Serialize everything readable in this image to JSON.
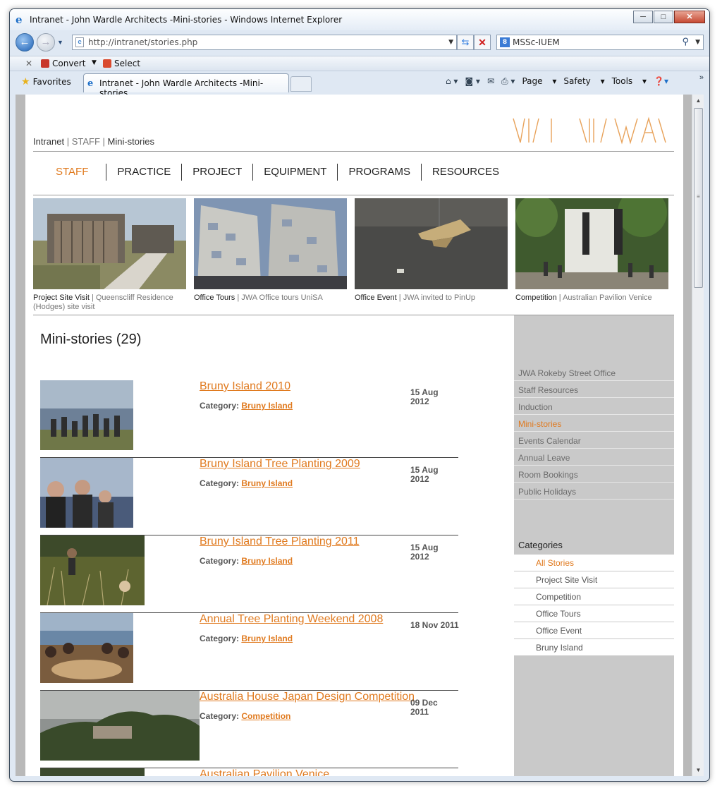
{
  "window": {
    "title": "Intranet - John Wardle Architects -Mini-stories - Windows Internet Explorer",
    "minimize": "─",
    "maximize": "□",
    "close": "✕"
  },
  "address": {
    "url": "http://intranet/stories.php"
  },
  "search": {
    "provider": "MSSc-IUEM"
  },
  "command_bar": {
    "convert": "Convert",
    "select": "Select"
  },
  "tabs": {
    "favorites": "Favorites",
    "active_tab": "Intranet - John Wardle Architects -Mini-stories"
  },
  "ie_tools": {
    "page": "Page",
    "safety": "Safety",
    "tools": "Tools"
  },
  "breadcrumb": {
    "home": "Intranet",
    "sep1": " | ",
    "section": "STAFF",
    "sep2": " | ",
    "current": "Mini-stories"
  },
  "main_nav": [
    "STAFF",
    "PRACTICE",
    "PROJECT",
    "EQUIPMENT",
    "PROGRAMS",
    "RESOURCES"
  ],
  "features": [
    {
      "category": "Project Site Visit",
      "sep": " | ",
      "title": "Queenscliff Residence (Hodges) site visit"
    },
    {
      "category": "Office Tours",
      "sep": " | ",
      "title": "JWA Office tours UniSA"
    },
    {
      "category": "Office Event",
      "sep": " | ",
      "title": "JWA invited to PinUp"
    },
    {
      "category": "Competition",
      "sep": " | ",
      "title": "Australian Pavilion Venice"
    }
  ],
  "heading": "Mini-stories (29)",
  "category_label": "Category:",
  "stories": [
    {
      "title": "Bruny Island 2010",
      "category": "Bruny Island",
      "date_day": "15 Aug",
      "date_year": "2012"
    },
    {
      "title": "Bruny Island Tree Planting 2009",
      "category": "Bruny Island",
      "date_day": "15 Aug",
      "date_year": "2012"
    },
    {
      "title": "Bruny Island Tree Planting 2011",
      "category": "Bruny Island",
      "date_day": "15 Aug",
      "date_year": "2012"
    },
    {
      "title": "Annual Tree Planting Weekend 2008",
      "category": "Bruny Island",
      "date_day": "18 Nov 2011",
      "date_year": ""
    },
    {
      "title": "Australia House Japan Design Competition",
      "category": "Competition",
      "date_day": "09 Dec",
      "date_year": "2011"
    },
    {
      "title": "Australian Pavilion Venice"
    }
  ],
  "sidebar": {
    "links": [
      "JWA Rokeby Street Office",
      "Staff Resources",
      "Induction",
      "Mini-stories",
      "Events Calendar",
      "Annual Leave",
      "Room Bookings",
      "Public Holidays"
    ],
    "active_link": "Mini-stories",
    "categories_heading": "Categories",
    "categories": [
      "All Stories",
      "Project Site Visit",
      "Competition",
      "Office Tours",
      "Office Event",
      "Bruny Island"
    ],
    "active_category": "All Stories"
  },
  "colors": {
    "accent": "#e07a1f",
    "sidebar_bg": "#c9c9c9",
    "text": "#222222"
  }
}
